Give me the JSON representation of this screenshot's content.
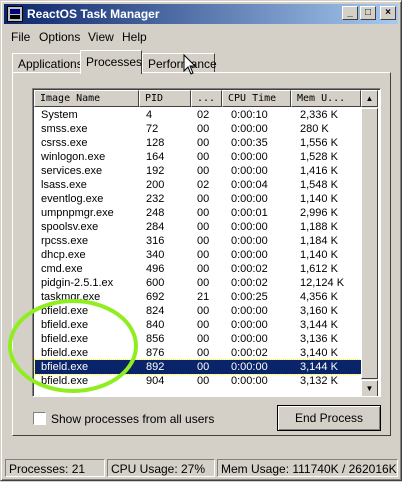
{
  "window": {
    "title": "ReactOS Task Manager"
  },
  "titlebar_buttons": {
    "minimize": "_",
    "maximize": "□",
    "close": "×"
  },
  "menu": {
    "file": "File",
    "options": "Options",
    "view": "View",
    "help": "Help"
  },
  "tabs": {
    "applications": "Applications",
    "processes": "Processes",
    "performance": "Performance"
  },
  "columns": {
    "image_name": "Image Name",
    "pid": "PID",
    "session": "...",
    "cpu_time": "CPU Time",
    "mem_usage": "Mem U..."
  },
  "processes": [
    {
      "name": "System",
      "pid": "4",
      "session": "02",
      "cpu": "0:00:10",
      "mem": "2,336 K"
    },
    {
      "name": "smss.exe",
      "pid": "72",
      "session": "00",
      "cpu": "0:00:00",
      "mem": "280 K"
    },
    {
      "name": "csrss.exe",
      "pid": "128",
      "session": "00",
      "cpu": "0:00:35",
      "mem": "1,556 K"
    },
    {
      "name": "winlogon.exe",
      "pid": "164",
      "session": "00",
      "cpu": "0:00:00",
      "mem": "1,528 K"
    },
    {
      "name": "services.exe",
      "pid": "192",
      "session": "00",
      "cpu": "0:00:00",
      "mem": "1,416 K"
    },
    {
      "name": "lsass.exe",
      "pid": "200",
      "session": "02",
      "cpu": "0:00:04",
      "mem": "1,548 K"
    },
    {
      "name": "eventlog.exe",
      "pid": "232",
      "session": "00",
      "cpu": "0:00:00",
      "mem": "1,140 K"
    },
    {
      "name": "umpnpmgr.exe",
      "pid": "248",
      "session": "00",
      "cpu": "0:00:01",
      "mem": "2,996 K"
    },
    {
      "name": "spoolsv.exe",
      "pid": "284",
      "session": "00",
      "cpu": "0:00:00",
      "mem": "1,188 K"
    },
    {
      "name": "rpcss.exe",
      "pid": "316",
      "session": "00",
      "cpu": "0:00:00",
      "mem": "1,184 K"
    },
    {
      "name": "dhcp.exe",
      "pid": "340",
      "session": "00",
      "cpu": "0:00:00",
      "mem": "1,140 K"
    },
    {
      "name": "cmd.exe",
      "pid": "496",
      "session": "00",
      "cpu": "0:00:02",
      "mem": "1,612 K"
    },
    {
      "name": "pidgin-2.5.1.ex",
      "pid": "600",
      "session": "00",
      "cpu": "0:00:02",
      "mem": "12,124 K"
    },
    {
      "name": "taskmgr.exe",
      "pid": "692",
      "session": "21",
      "cpu": "0:00:25",
      "mem": "4,356 K"
    },
    {
      "name": "bfield.exe",
      "pid": "824",
      "session": "00",
      "cpu": "0:00:00",
      "mem": "3,160 K"
    },
    {
      "name": "bfield.exe",
      "pid": "840",
      "session": "00",
      "cpu": "0:00:00",
      "mem": "3,144 K"
    },
    {
      "name": "bfield.exe",
      "pid": "856",
      "session": "00",
      "cpu": "0:00:00",
      "mem": "3,136 K"
    },
    {
      "name": "bfield.exe",
      "pid": "876",
      "session": "00",
      "cpu": "0:00:02",
      "mem": "3,140 K"
    },
    {
      "name": "bfield.exe",
      "pid": "892",
      "session": "00",
      "cpu": "0:00:00",
      "mem": "3,144 K",
      "selected": true
    },
    {
      "name": "bfield.exe",
      "pid": "904",
      "session": "00",
      "cpu": "0:00:00",
      "mem": "3,132 K"
    }
  ],
  "scroll_arrows": {
    "up": "▲",
    "down": "▼"
  },
  "options": {
    "show_all_users_label": "Show processes from all users",
    "show_all_users_checked": false
  },
  "buttons": {
    "end_process": "End Process"
  },
  "statusbar": {
    "processes": "Processes: 21",
    "cpu_usage": "CPU Usage:  27%",
    "mem_usage": "Mem Usage: 111740K / 262016K"
  },
  "colors": {
    "title_gradient_start": "#0a246a",
    "title_gradient_end": "#a6caf0",
    "selection": "#0a246a",
    "annotation_circle": "#90ee20"
  }
}
